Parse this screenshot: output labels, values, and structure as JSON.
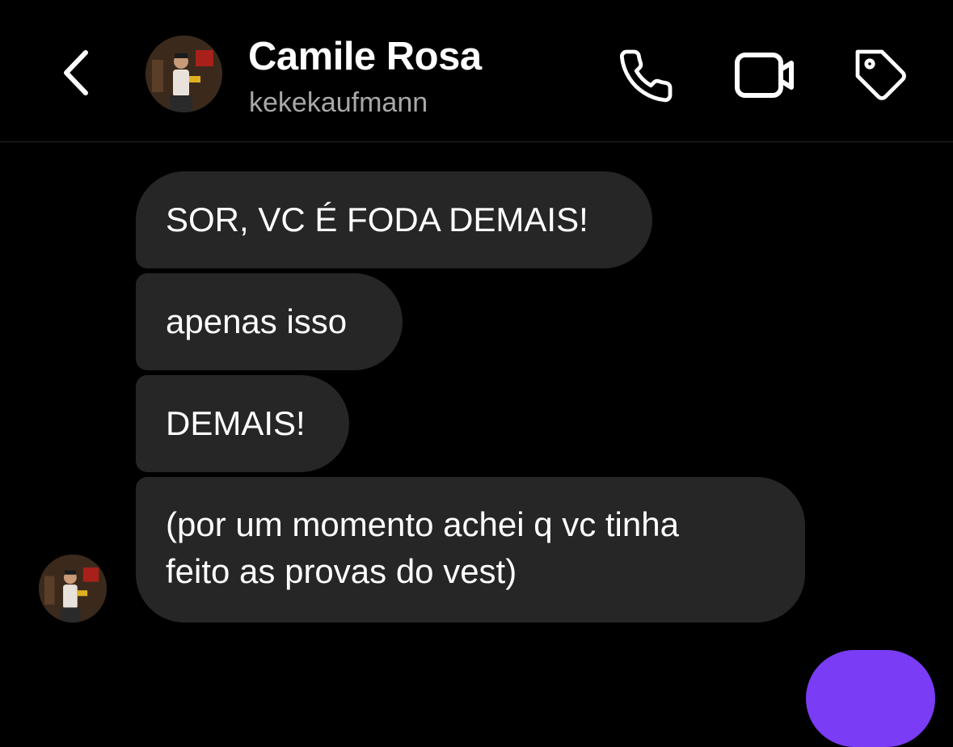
{
  "header": {
    "contact_name": "Camile Rosa",
    "username": "kekekaufmann",
    "icons": {
      "back": "chevron-left-icon",
      "call": "phone-icon",
      "video": "video-camera-icon",
      "tag": "tag-icon"
    }
  },
  "messages": [
    {
      "sender": "Camile Rosa",
      "text": "SOR, VC É FODA DEMAIS!"
    },
    {
      "sender": "Camile Rosa",
      "text": "apenas isso"
    },
    {
      "sender": "Camile Rosa",
      "text": "DEMAIS!"
    },
    {
      "sender": "Camile Rosa",
      "lines": [
        "(por um momento achei q vc tinha",
        "feito as provas do vest)"
      ]
    }
  ],
  "colors": {
    "background": "#000000",
    "received_bubble": "#262626",
    "sent_bubble": "#7a3cf5",
    "secondary_text": "#a8a8a8",
    "divider": "#262626"
  }
}
